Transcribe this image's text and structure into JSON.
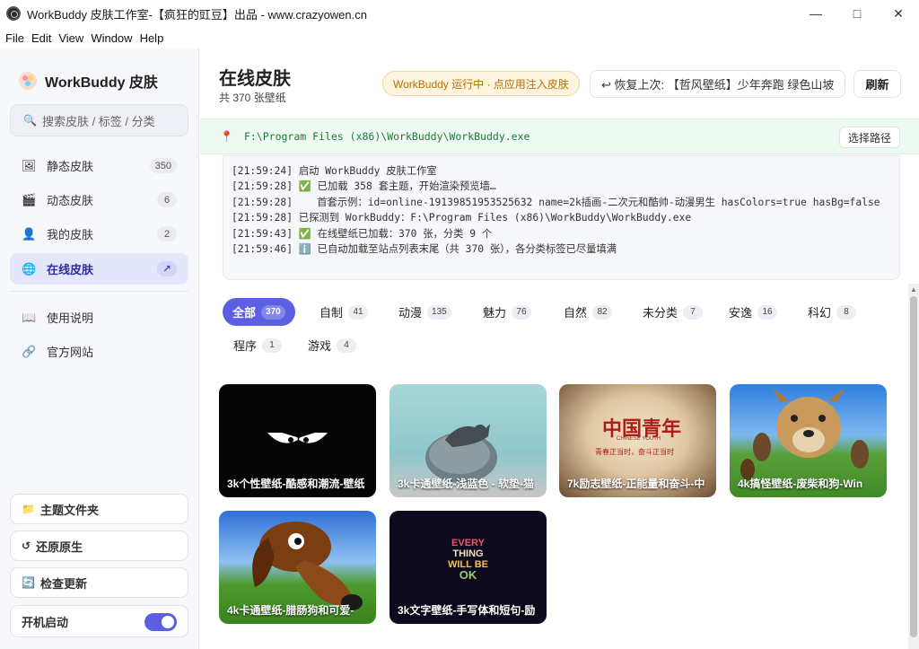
{
  "window": {
    "title": "WorkBuddy 皮肤工作室-【疯狂的豇豆】出品 - www.crazyowen.cn"
  },
  "menu": [
    "File",
    "Edit",
    "View",
    "Window",
    "Help"
  ],
  "sidebar": {
    "brand": "WorkBuddy 皮肤",
    "search_placeholder": "搜索皮肤 / 标签 / 分类",
    "items": [
      {
        "label": "静态皮肤",
        "badge": "350"
      },
      {
        "label": "动态皮肤",
        "badge": "6"
      },
      {
        "label": "我的皮肤",
        "badge": "2"
      },
      {
        "label": "在线皮肤",
        "badge": "↗"
      },
      {
        "label": "使用说明"
      },
      {
        "label": "官方网站"
      }
    ],
    "buttons": {
      "theme_folder": "主题文件夹",
      "restore": "还原原生",
      "check_update": "检查更新",
      "autostart": "开机启动"
    }
  },
  "header": {
    "title": "在线皮肤",
    "subtitle": "共 370 张壁纸",
    "status": "WorkBuddy 运行中 · 点应用注入皮肤",
    "restore_last": "↩ 恢复上次: 【哲风壁纸】少年奔跑 绿色山坡",
    "refresh": "刷新"
  },
  "path": {
    "value": "F:\\Program Files (x86)\\WorkBuddy\\WorkBuddy.exe",
    "choose": "选择路径"
  },
  "log": [
    "[21:59:24] 启动 WorkBuddy 皮肤工作室",
    "[21:59:28] ✅ 已加载 358 套主题，开始渲染预览墙…",
    "[21:59:28]    首套示例：id=online-19139851953525632 name=2k插画-二次元和酷帅-动漫男生 hasColors=true hasBg=false",
    "[21:59:28] 已探测到 WorkBuddy：F:\\Program Files (x86)\\WorkBuddy\\WorkBuddy.exe",
    "[21:59:43] ✅ 在线壁纸已加载：370 张，分类 9 个",
    "[21:59:46] ℹ️ 已自动加载至站点列表末尾（共 370 张），各分类标签已尽量填满"
  ],
  "categories": [
    {
      "label": "全部",
      "count": "370"
    },
    {
      "label": "自制",
      "count": "41"
    },
    {
      "label": "动漫",
      "count": "135"
    },
    {
      "label": "魅力",
      "count": "76"
    },
    {
      "label": "自然",
      "count": "82"
    },
    {
      "label": "未分类",
      "count": "7"
    },
    {
      "label": "安逸",
      "count": "16"
    },
    {
      "label": "科幻",
      "count": "8"
    },
    {
      "label": "程序",
      "count": "1"
    },
    {
      "label": "游戏",
      "count": "4"
    }
  ],
  "wallpapers": [
    {
      "caption": "3k个性壁纸-酷感和潮流-壁纸"
    },
    {
      "caption": "3k卡通壁纸-浅蓝色 - 软垫-猫"
    },
    {
      "caption": "7k励志壁纸-正能量和奋斗-中"
    },
    {
      "caption": "4k搞怪壁纸-废柴和狗-Win"
    },
    {
      "caption": "4k卡通壁纸-腊肠狗和可爱-"
    },
    {
      "caption": "3k文字壁纸-手写体和短句-励"
    }
  ],
  "wallpaper_art_text": {
    "card3_line1": "中国青年",
    "card3_line2": "CHINESE YOUTH",
    "card3_line3": "青春正当时，奋斗正当时",
    "card6": [
      "EVERY",
      "THING",
      "WILL BE",
      "OK"
    ]
  }
}
